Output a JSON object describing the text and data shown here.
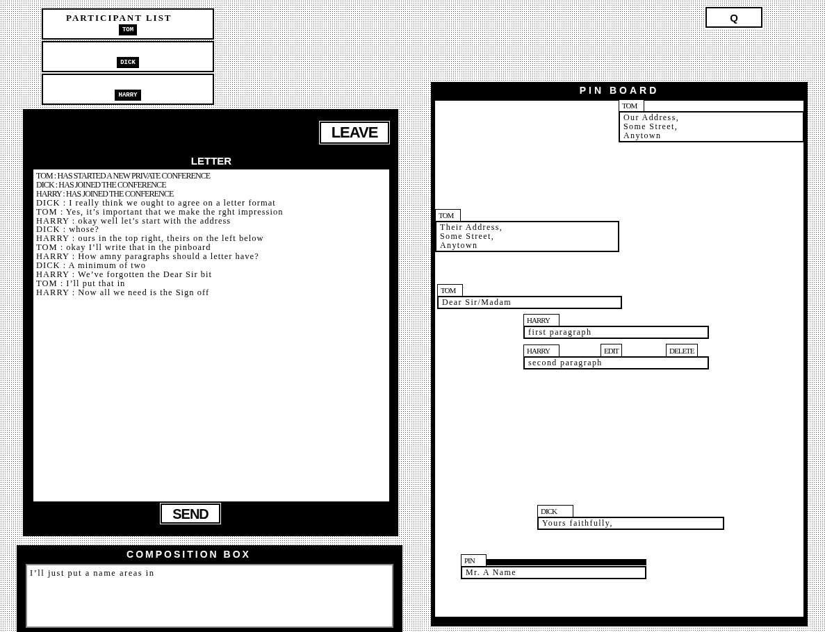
{
  "participant_list": {
    "title": "PARTICIPANT LIST",
    "participants": [
      {
        "name": "TOM"
      },
      {
        "name": "DICK"
      },
      {
        "name": "HARRY"
      }
    ]
  },
  "quit_button": "Q",
  "letter_panel": {
    "leave_button": "LEAVE",
    "title": "LETTER",
    "messages": [
      {
        "kind": "system",
        "text": "TOM : HAS STARTED A NEW PRIVATE CONFERENCE"
      },
      {
        "kind": "system",
        "text": "DICK : HAS JOINED THE CONFERENCE"
      },
      {
        "kind": "system",
        "text": "HARRY : HAS JOINED THE CONFERENCE"
      },
      {
        "kind": "message",
        "text": "DICK : I really think we ought to agree on a letter format"
      },
      {
        "kind": "message",
        "text": "TOM : Yes, it’s important that we make the rght impression"
      },
      {
        "kind": "message",
        "text": "HARRY : okay well let’s start with the address"
      },
      {
        "kind": "message",
        "text": "DICK : whose?"
      },
      {
        "kind": "message",
        "text": "HARRY : ours in the top right, theirs on the left below"
      },
      {
        "kind": "message",
        "text": "TOM : okay I’ll write that in the pinboard"
      },
      {
        "kind": "message",
        "text": "HARRY : How amny paragraphs should a letter have?"
      },
      {
        "kind": "message",
        "text": "DICK : A minimum of two"
      },
      {
        "kind": "message",
        "text": "HARRY : We’ve forgotten the Dear Sir bit"
      },
      {
        "kind": "message",
        "text": "TOM : I’ll put that in"
      },
      {
        "kind": "message",
        "text": "HARRY : Now all we need is the Sign off"
      }
    ],
    "send_button": "SEND"
  },
  "composition_box": {
    "title": "COMPOSITION BOX",
    "value": "I’ll just put a name areas in"
  },
  "pin_board": {
    "title": "PIN BOARD",
    "notes": [
      {
        "kind": "note",
        "author": "TOM",
        "lines": [
          "Our Address,",
          "Some Street,",
          "Anytown"
        ]
      },
      {
        "kind": "note",
        "author": "TOM",
        "lines": [
          "Their Address,",
          "Some Street,",
          "Anytown"
        ]
      },
      {
        "kind": "note",
        "author": "TOM",
        "lines": [
          "Dear Sir/Madam"
        ]
      },
      {
        "kind": "note",
        "author": "HARRY",
        "lines": [
          "first paragraph"
        ]
      },
      {
        "kind": "note",
        "author": "HARRY",
        "lines": [
          "second paragraph"
        ],
        "actions": [
          "EDIT",
          "DELETE"
        ]
      },
      {
        "kind": "note",
        "author": "DICK",
        "lines": [
          "Yours faithfully,"
        ]
      },
      {
        "kind": "pending",
        "author": "PIN",
        "lines": [
          "Mr. A Name"
        ]
      }
    ]
  }
}
